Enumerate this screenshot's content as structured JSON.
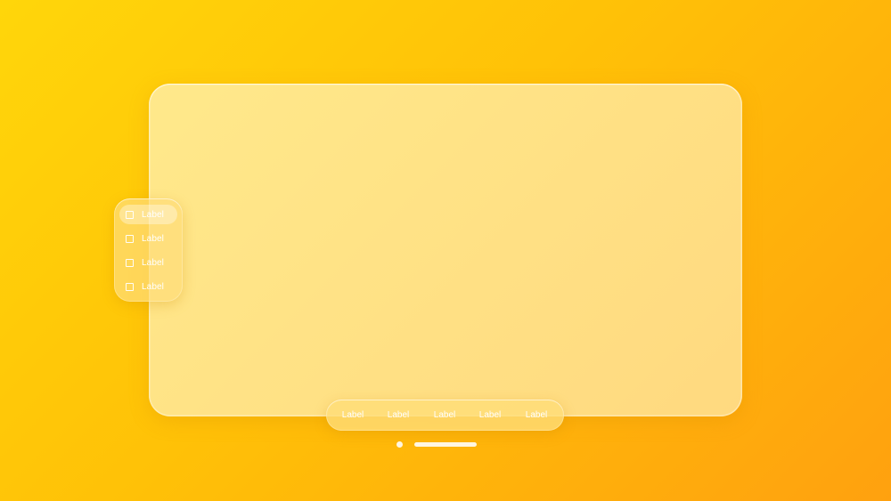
{
  "theme": {
    "background_start": "#FFD60A",
    "background_end": "#FFA10F",
    "window_tint": "#FFE18C",
    "text_color": "#FFFFFF"
  },
  "sidebar": {
    "items": [
      {
        "label": "Label",
        "icon": "square-icon",
        "selected": true
      },
      {
        "label": "Label",
        "icon": "square-icon",
        "selected": false
      },
      {
        "label": "Label",
        "icon": "square-icon",
        "selected": false
      },
      {
        "label": "Label",
        "icon": "square-icon",
        "selected": false
      }
    ]
  },
  "tabbar": {
    "tabs": [
      {
        "label": "Label"
      },
      {
        "label": "Label"
      },
      {
        "label": "Label"
      },
      {
        "label": "Label"
      },
      {
        "label": "Label"
      }
    ]
  }
}
